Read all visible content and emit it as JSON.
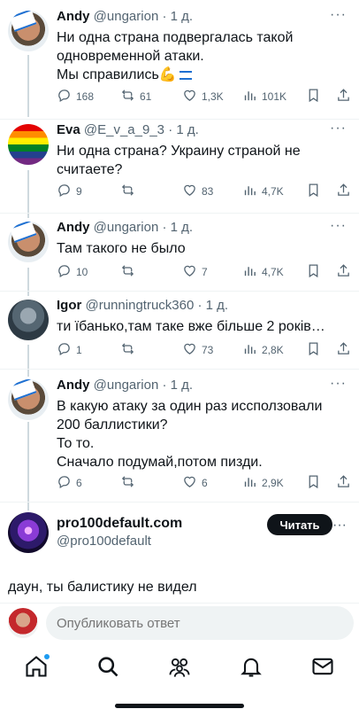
{
  "tweets": [
    {
      "name": "Andy",
      "handle": "@ungarion",
      "time": "1 д.",
      "text": "Ни одна страна подвергалась такой\nодновременной атаки.\nМы справились",
      "emoji": "💪",
      "replies": "168",
      "retweets": "61",
      "likes": "1,3K",
      "views": "101K"
    },
    {
      "name": "Eva",
      "handle": "@E_v_a_9_3",
      "time": "1 д.",
      "text": "Ни одна страна? Украину страной не\nсчитаете?",
      "replies": "9",
      "retweets": "",
      "likes": "83",
      "views": "4,7K"
    },
    {
      "name": "Andy",
      "handle": "@ungarion",
      "time": "1 д.",
      "text": "Там такого не было",
      "replies": "10",
      "retweets": "",
      "likes": "7",
      "views": "4,7K"
    },
    {
      "name": "Igor",
      "handle": "@runningtruck360",
      "time": "1 д.",
      "text": "ти їбанько,там таке вже більше 2 років…",
      "replies": "1",
      "retweets": "",
      "likes": "73",
      "views": "2,8K"
    },
    {
      "name": "Andy",
      "handle": "@ungarion",
      "time": "1 д.",
      "text": "В какую атаку за один раз иссползовали\n200 баллистики?\nТо то.\nСначало подумай,потом пизди.",
      "replies": "6",
      "retweets": "",
      "likes": "6",
      "views": "2,9K"
    }
  ],
  "ad": {
    "name": "pro100default.com",
    "handle": "@pro100default",
    "button": "Читать",
    "text": "даун, ты балистику не видел"
  },
  "reply": {
    "placeholder": "Опубликовать ответ"
  },
  "more_label": "···",
  "icons": {
    "reply": "comment-icon",
    "retweet": "retweet-icon",
    "like": "heart-icon",
    "views": "views-icon",
    "bookmark": "bookmark-icon",
    "share": "share-icon",
    "nav": [
      "home-icon",
      "search-icon",
      "communities-icon",
      "notifications-icon",
      "messages-icon"
    ]
  },
  "colors": {
    "text": "#0f1419",
    "secondary": "#536471",
    "accent": "#1d9bf0"
  }
}
